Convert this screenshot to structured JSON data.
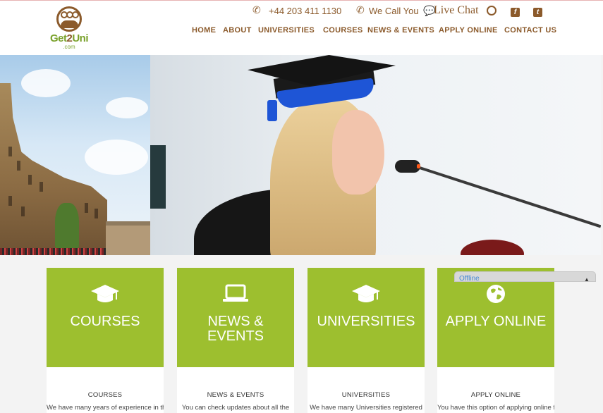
{
  "brand": {
    "name_a": "Get",
    "name_b": "2",
    "name_c": "Uni",
    "domain": ".com"
  },
  "topbar": {
    "phone": "+44 203 411 1130",
    "call_us": "We Call You",
    "live_chat": "Live Chat",
    "facebook": "f",
    "twitter": "t"
  },
  "nav": [
    "HOME",
    "ABOUT",
    "UNIVERSITIES",
    "COURSES",
    "NEWS & EVENTS",
    "APPLY ONLINE",
    "CONTACT US"
  ],
  "cards": [
    {
      "title": "COURSES",
      "subtitle": "COURSES",
      "desc": "We have many years of experience in this",
      "icon": "graduation-cap-icon"
    },
    {
      "title": "NEWS & EVENTS",
      "subtitle": "NEWS & EVENTS",
      "desc": "You can check updates about all the",
      "icon": "laptop-icon"
    },
    {
      "title": "UNIVERSITIES",
      "subtitle": "UNIVERSITIES",
      "desc": "We have many Universities registered",
      "icon": "graduation-cap-icon"
    },
    {
      "title": "APPLY ONLINE",
      "subtitle": "APPLY ONLINE",
      "desc": "You have this option of applying online for",
      "icon": "globe-icon"
    }
  ],
  "chat_widget": {
    "status": "Offline"
  },
  "colors": {
    "brand_brown": "#8b5a2b",
    "brand_green": "#9dbf2f"
  }
}
